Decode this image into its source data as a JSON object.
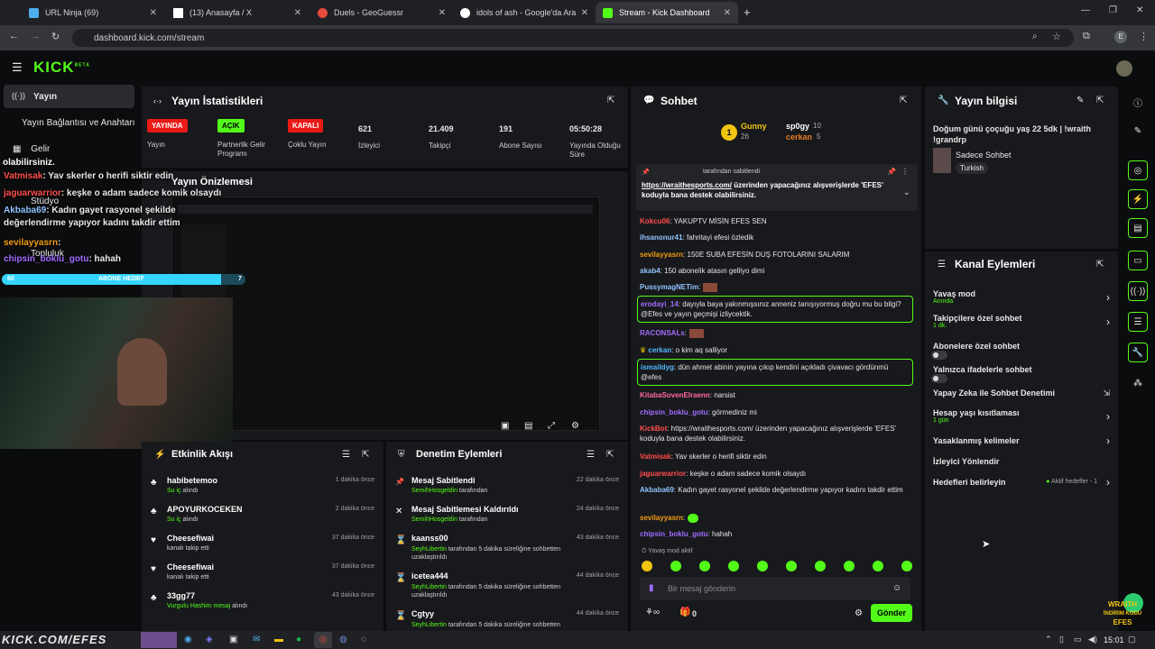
{
  "browser": {
    "tabs": [
      {
        "title": "URL Ninja (69)",
        "color": "#4cafef"
      },
      {
        "title": "(13) Anasayfa / X",
        "color": "#ffffff"
      },
      {
        "title": "Duels - GeoGuessr",
        "color": "#e74c3c"
      },
      {
        "title": "idols of ash - Google'da Ara",
        "color": "#ffffff"
      },
      {
        "title": "Stream - Kick Dashboard",
        "color": "#53fc18"
      }
    ],
    "url": "dashboard.kick.com/stream"
  },
  "kick": {
    "logo": "KICK",
    "beta": "BETA"
  },
  "sidebar": {
    "active": "Yayın",
    "items": [
      "Yayın Bağlantısı ve Anahtarı",
      "Gelir",
      "Stüdyo",
      "Topluluk"
    ]
  },
  "stats": {
    "title": "Yayın İstatistikleri",
    "items": [
      {
        "badge": "YAYINDA",
        "badge_color": "#e91916",
        "label": "Yayın"
      },
      {
        "badge": "AÇIK",
        "badge_color": "#53fc18",
        "label": "Partnerlik Gelir Programı"
      },
      {
        "badge": "KAPALI",
        "badge_color": "#e91916",
        "label": "Çoklu Yayın"
      },
      {
        "value": "621",
        "label": "İzleyici"
      },
      {
        "value": "21.409",
        "label": "Takipçi"
      },
      {
        "value": "191",
        "label": "Abone Sayısı"
      },
      {
        "value": "05:50:28",
        "label": "Yayında Olduğu Süre"
      }
    ]
  },
  "preview": {
    "title": "Yayın Önizlemesi"
  },
  "overlay": {
    "chat": [
      {
        "user": "Vatmisak",
        "text": ": Yav skerler o herifi siktir edin"
      },
      {
        "user": "jaguarwarrior",
        "text": ": keşke o adam sadece komik olsaydı"
      },
      {
        "user": "Akbaba69",
        "text": ": Kadın gayet rasyonel şekilde değerlendirme yapıyor kadını takdir ettim"
      },
      {
        "user": "sevilayyasrn",
        "text": ":"
      },
      {
        "user": "chipsin_boklu_gotu",
        "text": ": hahah"
      }
    ],
    "fragment": "olabilirsiniz.",
    "sub_goal": {
      "left": "60",
      "label": "ABONE HEDEF",
      "right": "7",
      "progress": 0.9
    },
    "bottom_text": "KICK.COM/EFES",
    "wraith": {
      "line1": "WRAITH",
      "line2": "İNDİRİM KODU",
      "line3": "EFES"
    }
  },
  "activity": {
    "title": "Etkinlik Akışı",
    "rows": [
      {
        "name": "habibetemoo",
        "detail": "Su iç",
        "detail2": " alındı",
        "time": "1 dakika önce",
        "icon": "♣"
      },
      {
        "name": "APOYURKOCEKEN",
        "detail": "Su iç",
        "detail2": " alındı",
        "time": "2 dakika önce",
        "icon": "♣"
      },
      {
        "name": "Cheesefiwai",
        "detail": "",
        "detail2": "kanalı takip etti",
        "time": "37 dakika önce",
        "icon": "♥"
      },
      {
        "name": "Cheesefiwai",
        "detail": "",
        "detail2": "kanalı takip etti",
        "time": "37 dakika önce",
        "icon": "♥"
      },
      {
        "name": "33gg77",
        "detail": "Vurgulu Hashim mesaj",
        "detail2": " alındı",
        "time": "43 dakika önce",
        "icon": "♣"
      }
    ]
  },
  "moderation": {
    "title": "Denetim Eylemleri",
    "rows": [
      {
        "title": "Mesaj Sabitlendi",
        "user": "SemihHosgeldin",
        "rest": " tarafından",
        "time": "22 dakika önce",
        "icon": "📌"
      },
      {
        "title": "Mesaj Sabitlemesi Kaldırıldı",
        "user": "SemihHosgeldin",
        "rest": " tarafından",
        "time": "24 dakika önce",
        "icon": "✕"
      },
      {
        "title": "kaanss00",
        "user": "SeyhLibertin",
        "rest": " tarafından 5 dakika süreliğine sohbetten uzaklaştırıldı",
        "time": "43 dakika önce",
        "icon": "⌛"
      },
      {
        "title": "icetea444",
        "user": "SeyhLibertin",
        "rest": " tarafından 5 dakika süreliğine sohbetten uzaklaştırıldı",
        "time": "44 dakika önce",
        "icon": "⌛"
      },
      {
        "title": "Cgtyy",
        "user": "SeyhLibertin",
        "rest": " tarafından 5 dakika süreliğine sohbetten",
        "time": "44 dakika önce",
        "icon": "⌛"
      }
    ]
  },
  "chat": {
    "title": "Sohbet",
    "leaders": [
      {
        "name": "Gunny",
        "count": "26",
        "color": "#f1c40f"
      },
      {
        "name": "sp0gy",
        "count": "10",
        "color": "#ffffff"
      },
      {
        "name": "cerkan",
        "count": "5",
        "color": "#e67e22"
      }
    ],
    "pinned": {
      "by": "tarafından sabitlendi",
      "link": "https://wraithesports.com/",
      "text": " üzerinden yapacağınız alışverişlerde 'EFES' koduyla bana destek olabilirsiniz."
    },
    "messages": [
      {
        "user": "Kokcu06",
        "color": "#ff4d4d",
        "text": ": YAKUPTV MİSİN EFES SEN"
      },
      {
        "user": "ihsanonur41",
        "color": "#8fc3ff",
        "text": ": fahritayi efesi özledik"
      },
      {
        "user": "sevilayyasrn",
        "color": "#f39c12",
        "text": ": 150E SUBA EFESİN DUŞ FOTOLARINI SALARIM"
      },
      {
        "user": "akab4",
        "color": "#8fc3ff",
        "text": ": 150 abonelik atasın gelliyo dimi"
      },
      {
        "user": "PussymagNETim",
        "color": "#8fc3ff",
        "text": ":"
      },
      {
        "user": "erodayi_14",
        "color": "#a06cff",
        "text": ": dayıyla baya yakınmışsınız anneniz tanışıyormuş doğru mu bu bilgi? @Efes ve yayın geçmişi izliycektik."
      },
      {
        "user": "RACONSALs",
        "color": "#a06cff",
        "text": ":"
      },
      {
        "user": "cerkan",
        "color": "#53b8ff",
        "text": ": o kim aq salliyor"
      },
      {
        "user": "ismaildyg",
        "color": "#53b8ff",
        "text": ": dün ahmet abinin yayına çıkıp kendini açıkladı çivavacı gördünmü @efes"
      },
      {
        "user": "KitabaSovenElraenn",
        "color": "#ff6b9e",
        "text": ": narsist"
      },
      {
        "user": "chipsin_boklu_gotu",
        "color": "#a06cff",
        "text": ": görmediniz mi"
      },
      {
        "user": "KickBot",
        "color": "#ff4d4d",
        "text": ": https://wraithesports.com/ üzerinden yapacağınız alışverişlerde 'EFES' koduyla bana destek olabilirsiniz."
      },
      {
        "user": "Vatmisak",
        "color": "#ff4d4d",
        "text": ": Yav skerler o herifi siktir edin"
      },
      {
        "user": "jaguarwarrior",
        "color": "#ff4d4d",
        "text": ": keşke o adam sadece komik olsaydı"
      },
      {
        "user": "Akbaba69",
        "color": "#8fc3ff",
        "text": ": Kadın gayet rasyonel şekilde değerlendirme yapıyor kadını takdir ettim"
      },
      {
        "user": "sevilayyasrn",
        "color": "#f39c12",
        "text": ":"
      },
      {
        "user": "chipsin_boklu_gotu",
        "color": "#a06cff",
        "text": ": hahah"
      }
    ],
    "slow_mode": "Yavaş mod aktif",
    "placeholder": "Bir mesaj gönderin",
    "points": "0",
    "send": "Gönder"
  },
  "stream_info": {
    "title": "Yayın bilgisi",
    "stream_title": "Doğum günü çoçuğu yaş 22 5dk | !wraith !grandrp",
    "category": "Sadece Sohbet",
    "tag": "Turkish"
  },
  "channel_actions": {
    "title": "Kanal Eylemleri",
    "items": [
      {
        "label": "Yavaş mod",
        "sub": "Anında",
        "control": "chevron"
      },
      {
        "label": "Takipçilere özel sohbet",
        "sub": "1 dk.",
        "control": "chevron"
      },
      {
        "label": "Abonelere özel sohbet",
        "sub": "",
        "control": "toggle"
      },
      {
        "label": "Yalnızca ifadelerle sohbet",
        "sub": "",
        "control": "toggle"
      },
      {
        "label": "Yapay Zeka ile Sohbet Denetimi",
        "sub": "",
        "control": "external"
      },
      {
        "label": "Hesap yaşı kısıtlaması",
        "sub": "1 gün",
        "control": "chevron"
      },
      {
        "label": "Yasaklanmış kelimeler",
        "sub": "",
        "control": "chevron"
      },
      {
        "label": "İzleyici Yönlendir",
        "sub": "",
        "control": "none"
      },
      {
        "label": "Hedefleri belirleyin",
        "sub": "",
        "control": "chevron",
        "status": "Aktif hedefler - 1"
      }
    ]
  },
  "taskbar": {
    "time": "15:01"
  }
}
